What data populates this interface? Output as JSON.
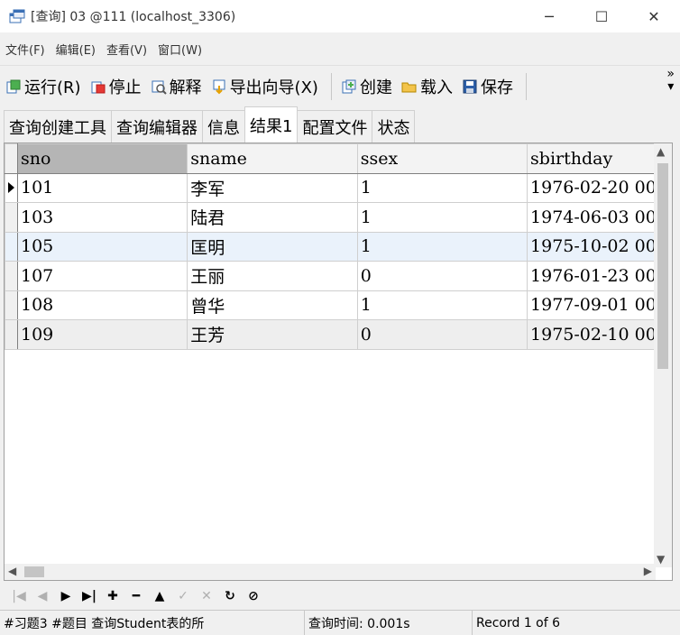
{
  "window": {
    "title": "[查询] 03 @111 (localhost_3306)",
    "minimize": "─",
    "maximize": "☐",
    "close": "✕"
  },
  "menu": [
    "文件(F)",
    "编辑(E)",
    "查看(V)",
    "窗口(W)"
  ],
  "toolbar": {
    "run": "运行(R)",
    "stop": "停止",
    "explain": "解释",
    "export": "导出向导(X)",
    "create": "创建",
    "load": "载入",
    "save": "保存",
    "more": "»"
  },
  "tabs": [
    "查询创建工具",
    "查询编辑器",
    "信息",
    "结果1",
    "配置文件",
    "状态"
  ],
  "active_tab": "结果1",
  "grid": {
    "columns": [
      "sno",
      "sname",
      "ssex",
      "sbirthday"
    ],
    "rows": [
      [
        "101",
        "李军",
        "1",
        "1976-02-20 00"
      ],
      [
        "103",
        "陆君",
        "1",
        "1974-06-03 00"
      ],
      [
        "105",
        "匡明",
        "1",
        "1975-10-02 00"
      ],
      [
        "107",
        "王丽",
        "0",
        "1976-01-23 00"
      ],
      [
        "108",
        "曾华",
        "1",
        "1977-09-01 00"
      ],
      [
        "109",
        "王芳",
        "0",
        "1975-02-10 00"
      ]
    ]
  },
  "status": {
    "sql": "#习题3 #题目 查询Student表的所",
    "time": "查询时间: 0.001s",
    "record": "Record 1 of 6"
  }
}
